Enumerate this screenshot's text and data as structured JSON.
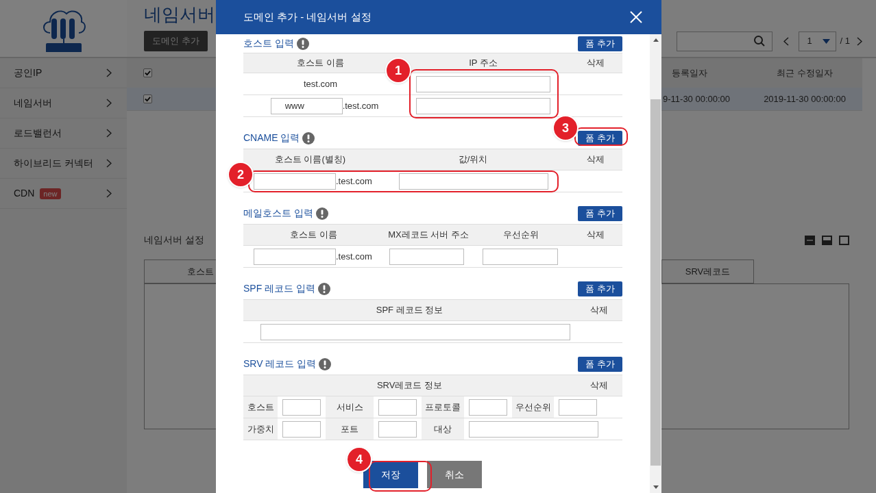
{
  "sidebar": {
    "items": [
      {
        "label": "공인IP"
      },
      {
        "label": "네임서버"
      },
      {
        "label": "로드밸런서"
      },
      {
        "label": "하이브리드 커넥터"
      },
      {
        "label": "CDN",
        "badge": "new"
      }
    ]
  },
  "main": {
    "title": "네임서버",
    "add_button": "도메인 추가",
    "pagination": {
      "page": "1",
      "total": "/ 1"
    },
    "table": {
      "columns": [
        "등록일자",
        "최근 수정일자"
      ],
      "header_checked": true,
      "rows": [
        {
          "checked": true,
          "selected": true,
          "cells": [
            "9-11-30 00:00:00",
            "2019-11-30 00:00:00"
          ]
        }
      ]
    },
    "settings": {
      "title": "네임서버 설정",
      "tabs": [
        "호스트",
        "SRV레코드"
      ]
    }
  },
  "dialog": {
    "title": "도메인 추가 - 네임서버 설정",
    "sections": [
      {
        "kind": "host",
        "title": "호스트 입력",
        "add_button": "폼 추가",
        "columns": [
          "호스트 이름",
          "IP 주소",
          "삭제"
        ],
        "rows": [
          {
            "kind": "fixed",
            "host": "test.com"
          },
          {
            "kind": "sub",
            "value": "www",
            "suffix": ".test.com"
          }
        ]
      },
      {
        "kind": "cname",
        "title": "CNAME 입력",
        "add_button": "폼 추가",
        "columns": [
          "호스트 이름(별칭)",
          "값/위치",
          "삭제"
        ],
        "rows": [
          {
            "suffix": ".test.com"
          }
        ]
      },
      {
        "kind": "mx",
        "title": "메일호스트 입력",
        "add_button": "폼 추가",
        "columns": [
          "호스트 이름",
          "MX레코드 서버 주소",
          "우선순위",
          "삭제"
        ],
        "rows": [
          {
            "suffix": ".test.com"
          }
        ]
      },
      {
        "kind": "spf",
        "title": "SPF 레코드 입력",
        "add_button": "폼 추가",
        "columns": [
          "SPF 레코드 정보",
          "삭제"
        ]
      },
      {
        "kind": "srv",
        "title": "SRV 레코드 입력",
        "add_button": "폼 추가",
        "columns": [
          "SRV레코드 정보",
          "삭제"
        ],
        "fields": [
          [
            "호스트",
            "서비스",
            "프로토콜",
            "우선순위"
          ],
          [
            "가중치",
            "포트",
            "대상"
          ]
        ]
      }
    ],
    "save": "저장",
    "cancel": "취소",
    "annotations": [
      "1",
      "2",
      "3",
      "4"
    ]
  }
}
